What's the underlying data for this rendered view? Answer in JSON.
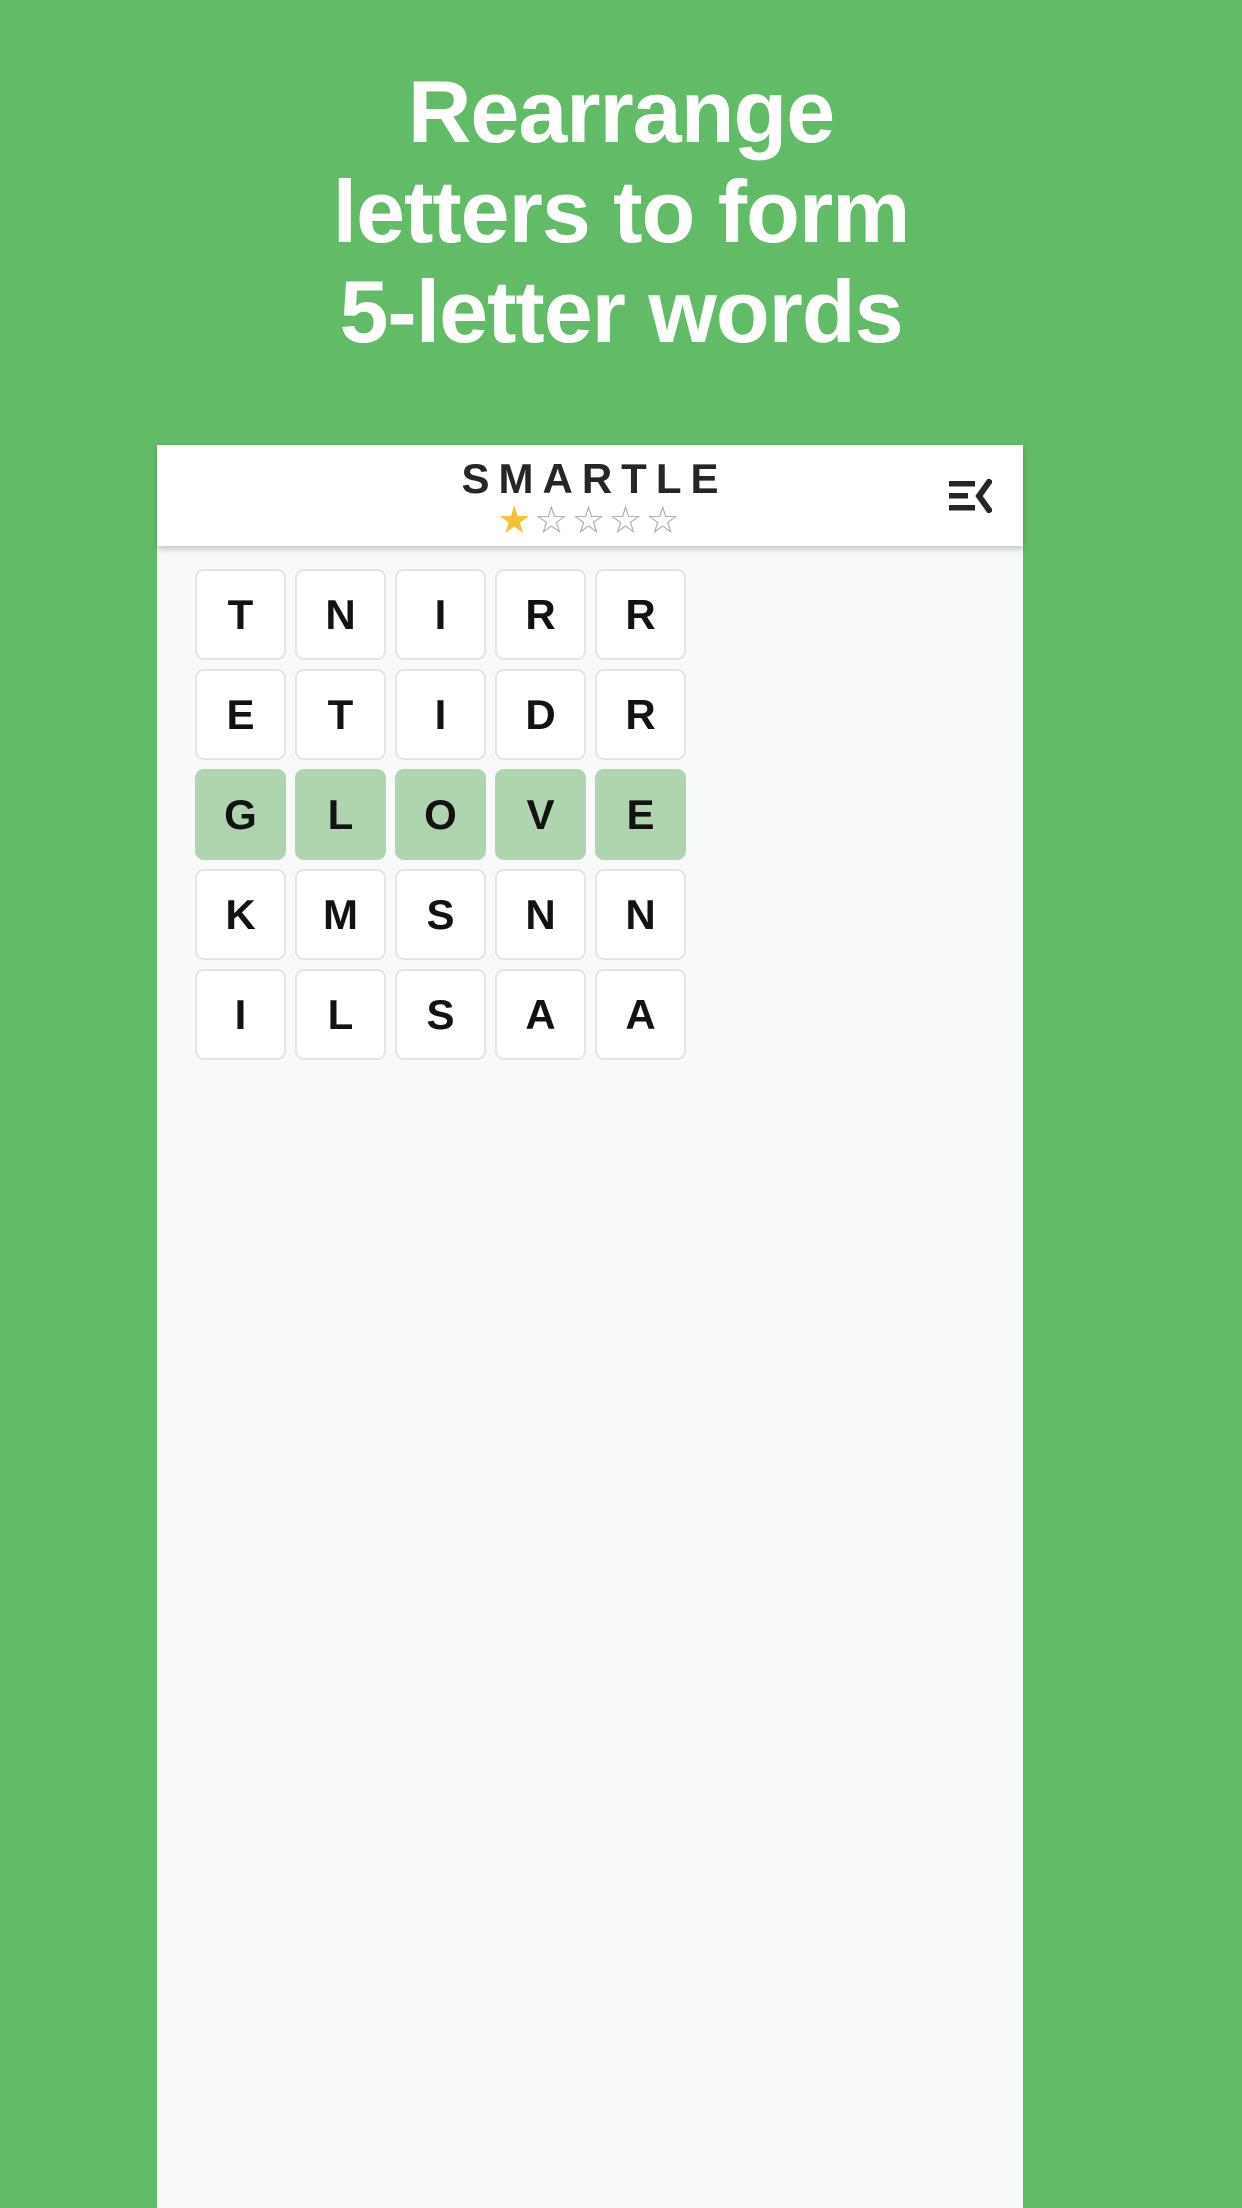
{
  "promo": {
    "lines": [
      "Rearrange",
      "letters to form",
      "5-letter words"
    ],
    "background_color": "#62bb66",
    "text_color": "#ffffff"
  },
  "app": {
    "header": {
      "brand_title": "SMARTLE",
      "rating": {
        "value": 1,
        "max": 5,
        "filled_glyph": "★",
        "empty_glyph": "☆",
        "filled_color": "#f5c036",
        "empty_color": "#a8a8a8"
      },
      "menu_button_label": "menu-fold"
    },
    "board": {
      "columns": 5,
      "rows": 5,
      "solved_row_color": "#aed5ae",
      "tile_color": "#ffffff",
      "tile_border_color": "#e3e3e3",
      "grid": [
        {
          "letters": [
            "T",
            "N",
            "I",
            "R",
            "R"
          ],
          "solved": false
        },
        {
          "letters": [
            "E",
            "T",
            "I",
            "D",
            "R"
          ],
          "solved": false
        },
        {
          "letters": [
            "G",
            "L",
            "O",
            "V",
            "E"
          ],
          "solved": true
        },
        {
          "letters": [
            "K",
            "M",
            "S",
            "N",
            "N"
          ],
          "solved": false
        },
        {
          "letters": [
            "I",
            "L",
            "S",
            "A",
            "A"
          ],
          "solved": false
        }
      ]
    }
  }
}
